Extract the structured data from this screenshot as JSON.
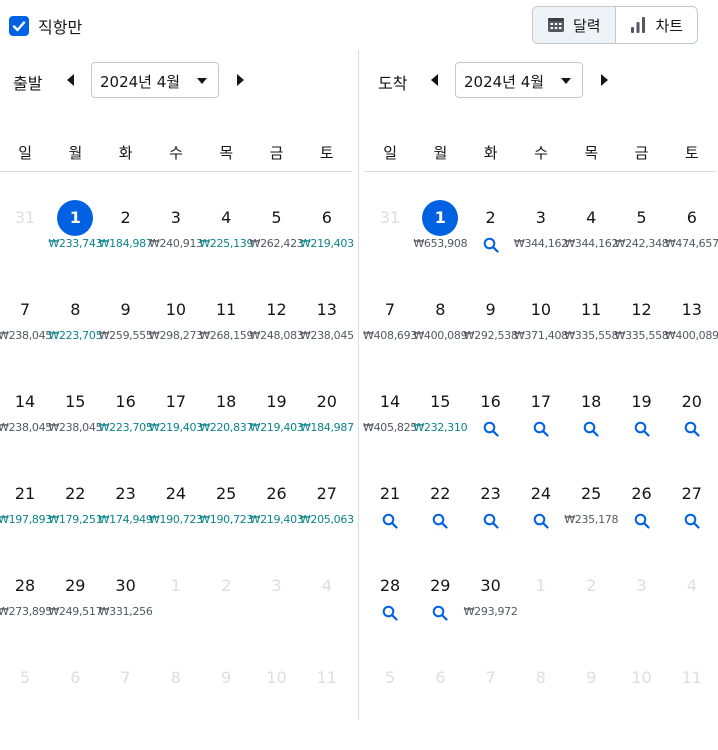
{
  "top": {
    "direct_only_label": "직항만",
    "direct_only_checked": true,
    "view_calendar_label": "달력",
    "view_chart_label": "차트",
    "active_view": "calendar"
  },
  "colors": {
    "accent": "#0062e3",
    "low_price": "#0c838a",
    "price": "#545860",
    "muted": "#dddde5"
  },
  "weekdays": [
    "일",
    "월",
    "화",
    "수",
    "목",
    "금",
    "토"
  ],
  "departure": {
    "title": "출발",
    "month": "2024년 4월",
    "days": [
      {
        "d": "31",
        "out": true
      },
      {
        "d": "1",
        "sel": true,
        "p": "₩233,743",
        "low": true
      },
      {
        "d": "2",
        "p": "₩184,987",
        "low": true
      },
      {
        "d": "3",
        "p": "₩240,913"
      },
      {
        "d": "4",
        "p": "₩225,139",
        "low": true
      },
      {
        "d": "5",
        "p": "₩262,423"
      },
      {
        "d": "6",
        "p": "₩219,403",
        "low": true
      },
      {
        "d": "7",
        "p": "₩238,045"
      },
      {
        "d": "8",
        "p": "₩223,705",
        "low": true
      },
      {
        "d": "9",
        "p": "₩259,555"
      },
      {
        "d": "10",
        "p": "₩298,273"
      },
      {
        "d": "11",
        "p": "₩268,159"
      },
      {
        "d": "12",
        "p": "₩248,083"
      },
      {
        "d": "13",
        "p": "₩238,045"
      },
      {
        "d": "14",
        "p": "₩238,045"
      },
      {
        "d": "15",
        "p": "₩238,045"
      },
      {
        "d": "16",
        "p": "₩223,705",
        "low": true
      },
      {
        "d": "17",
        "p": "₩219,403",
        "low": true
      },
      {
        "d": "18",
        "p": "₩220,837",
        "low": true
      },
      {
        "d": "19",
        "p": "₩219,403",
        "low": true
      },
      {
        "d": "20",
        "p": "₩184,987",
        "low": true
      },
      {
        "d": "21",
        "p": "₩197,893",
        "low": true
      },
      {
        "d": "22",
        "p": "₩179,251",
        "low": true
      },
      {
        "d": "23",
        "p": "₩174,949",
        "low": true
      },
      {
        "d": "24",
        "p": "₩190,723",
        "low": true
      },
      {
        "d": "25",
        "p": "₩190,723",
        "low": true
      },
      {
        "d": "26",
        "p": "₩219,403",
        "low": true
      },
      {
        "d": "27",
        "p": "₩205,063",
        "low": true
      },
      {
        "d": "28",
        "p": "₩273,895"
      },
      {
        "d": "29",
        "p": "₩249,517"
      },
      {
        "d": "30",
        "p": "₩331,256"
      },
      {
        "d": "1",
        "out": true
      },
      {
        "d": "2",
        "out": true
      },
      {
        "d": "3",
        "out": true
      },
      {
        "d": "4",
        "out": true
      },
      {
        "d": "5",
        "out": true
      },
      {
        "d": "6",
        "out": true
      },
      {
        "d": "7",
        "out": true
      },
      {
        "d": "8",
        "out": true
      },
      {
        "d": "9",
        "out": true
      },
      {
        "d": "10",
        "out": true
      },
      {
        "d": "11",
        "out": true
      }
    ]
  },
  "arrival": {
    "title": "도착",
    "month": "2024년 4월",
    "days": [
      {
        "d": "31",
        "out": true
      },
      {
        "d": "1",
        "sel": true,
        "p": "₩653,908"
      },
      {
        "d": "2",
        "search": true
      },
      {
        "d": "3",
        "p": "₩344,162"
      },
      {
        "d": "4",
        "p": "₩344,162"
      },
      {
        "d": "5",
        "p": "₩242,348"
      },
      {
        "d": "6",
        "p": "₩474,657"
      },
      {
        "d": "7",
        "p": "₩408,693"
      },
      {
        "d": "8",
        "p": "₩400,089"
      },
      {
        "d": "9",
        "p": "₩292,538"
      },
      {
        "d": "10",
        "p": "₩371,408"
      },
      {
        "d": "11",
        "p": "₩335,558"
      },
      {
        "d": "12",
        "p": "₩335,558"
      },
      {
        "d": "13",
        "p": "₩400,089"
      },
      {
        "d": "14",
        "p": "₩405,825"
      },
      {
        "d": "15",
        "p": "₩232,310",
        "low": true
      },
      {
        "d": "16",
        "search": true
      },
      {
        "d": "17",
        "search": true
      },
      {
        "d": "18",
        "search": true
      },
      {
        "d": "19",
        "search": true
      },
      {
        "d": "20",
        "search": true
      },
      {
        "d": "21",
        "search": true
      },
      {
        "d": "22",
        "search": true
      },
      {
        "d": "23",
        "search": true
      },
      {
        "d": "24",
        "search": true
      },
      {
        "d": "25",
        "p": "₩235,178"
      },
      {
        "d": "26",
        "search": true
      },
      {
        "d": "27",
        "search": true
      },
      {
        "d": "28",
        "search": true
      },
      {
        "d": "29",
        "search": true
      },
      {
        "d": "30",
        "p": "₩293,972"
      },
      {
        "d": "1",
        "out": true
      },
      {
        "d": "2",
        "out": true
      },
      {
        "d": "3",
        "out": true
      },
      {
        "d": "4",
        "out": true
      },
      {
        "d": "5",
        "out": true
      },
      {
        "d": "6",
        "out": true
      },
      {
        "d": "7",
        "out": true
      },
      {
        "d": "8",
        "out": true
      },
      {
        "d": "9",
        "out": true
      },
      {
        "d": "10",
        "out": true
      },
      {
        "d": "11",
        "out": true
      }
    ]
  }
}
